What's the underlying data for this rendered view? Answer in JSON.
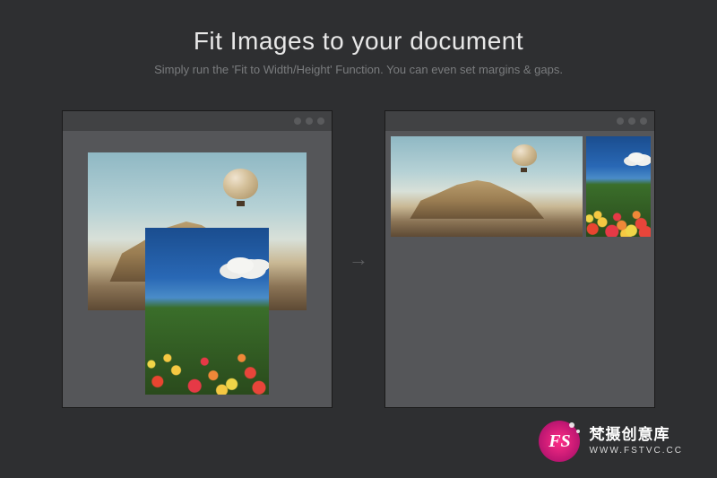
{
  "header": {
    "title": "Fit Images to your document",
    "subtitle": "Simply run the 'Fit to Width/Height' Function. You can even set margins & gaps."
  },
  "arrow": "→",
  "panels": {
    "left": {
      "images": [
        {
          "name": "balloon-landscape",
          "desc": "Hot air balloon over desert mountain"
        },
        {
          "name": "tulip-field",
          "desc": "Colorful tulip field under blue sky"
        }
      ]
    },
    "right": {
      "images": [
        {
          "name": "balloon-landscape",
          "desc": "Hot air balloon over desert mountain (fitted)"
        },
        {
          "name": "tulip-field",
          "desc": "Tulip field (fitted)"
        }
      ]
    }
  },
  "watermark": {
    "badge": "FS",
    "brand_cn": "梵摄创意库",
    "url": "WWW.FSTVC.CC"
  },
  "colors": {
    "background": "#2e2f31",
    "panel": "#555659",
    "titlebar": "#414244",
    "accent": "#ff2d87"
  }
}
